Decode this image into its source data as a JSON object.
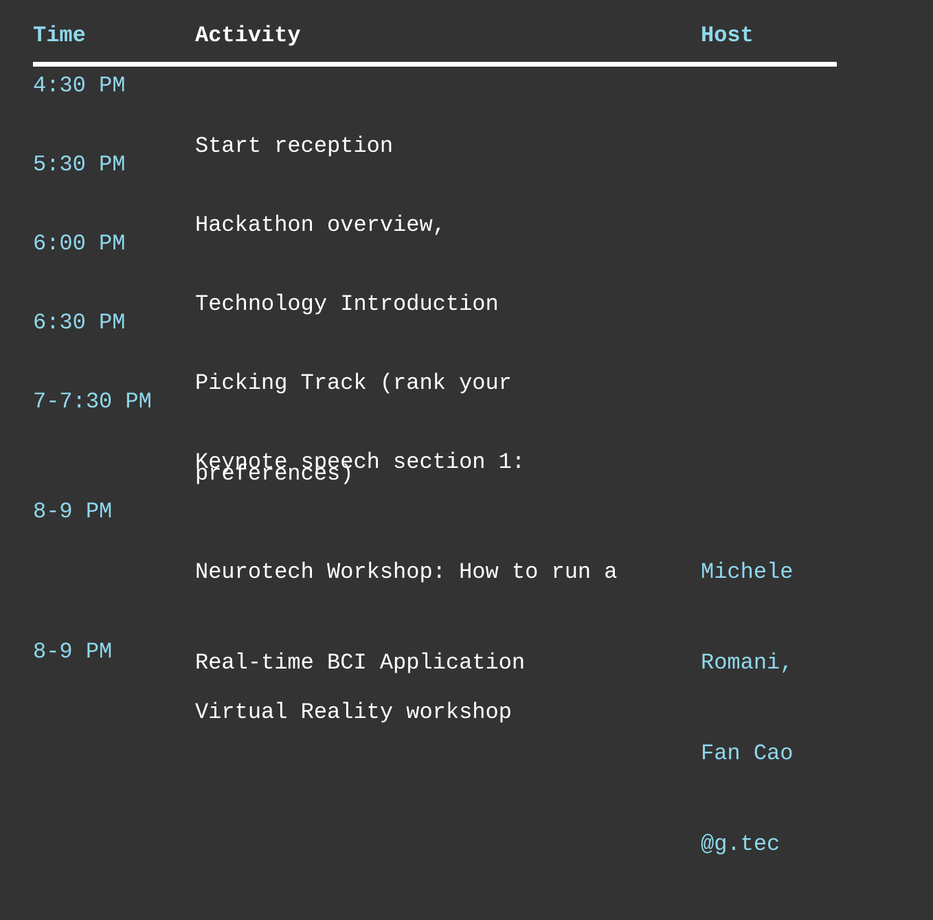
{
  "header": {
    "time": "Time",
    "activity": "Activity",
    "host": "Host"
  },
  "colors": {
    "background": "#333333",
    "accent": "#8fd8ec",
    "text": "#ffffff"
  },
  "rows": [
    {
      "time": "4:30 PM",
      "activity": [
        "Start reception"
      ],
      "host": []
    },
    {
      "time": "5:30 PM",
      "activity": [
        "Hackathon overview,"
      ],
      "host": []
    },
    {
      "time": "6:00 PM",
      "activity": [
        "Technology Introduction"
      ],
      "host": []
    },
    {
      "time": "6:30 PM",
      "activity": [
        "Picking Track (rank your",
        "preferences)"
      ],
      "host": []
    },
    {
      "time": "7-7:30 PM",
      "activity": [
        "Keynote speech section 1:"
      ],
      "host": []
    },
    {
      "time": "8-9 PM",
      "activity": [
        "Neurotech Workshop: How to run a",
        "Real-time BCI Application"
      ],
      "host": [
        "Michele",
        "Romani,",
        "Fan Cao",
        "@g.tec"
      ]
    },
    {
      "time": "8-9 PM",
      "activity": [
        "Virtual Reality workshop"
      ],
      "host": []
    }
  ]
}
